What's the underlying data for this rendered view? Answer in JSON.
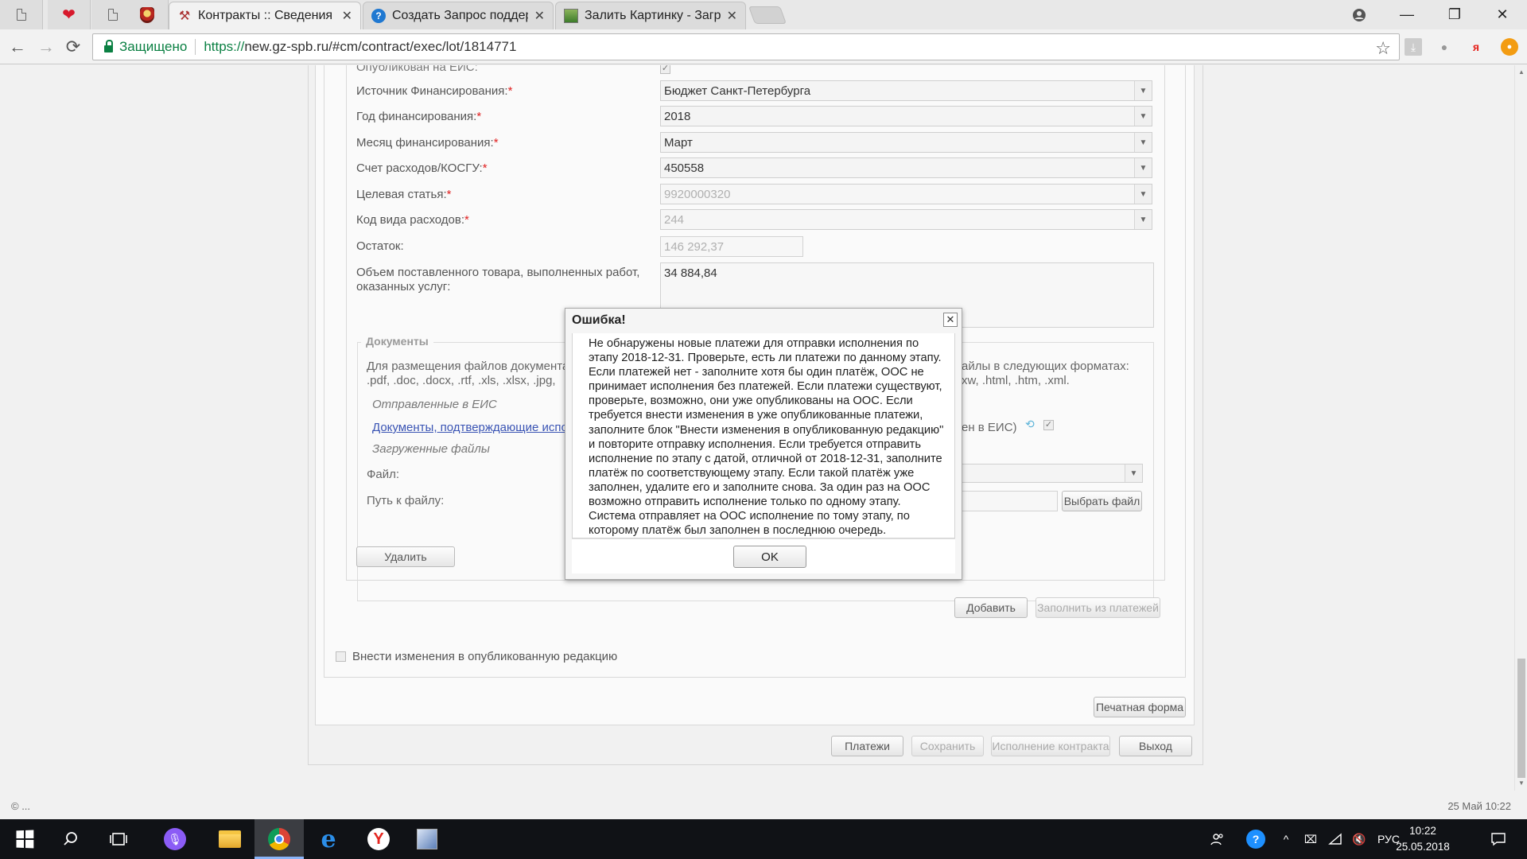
{
  "browser": {
    "tabs": [
      {
        "title": "Контракты :: Сведения о",
        "active": true,
        "icon": "tools-icon"
      },
      {
        "title": "Создать Запрос поддерж",
        "active": false,
        "icon": "help-icon"
      },
      {
        "title": "Залить Картинку - Загру",
        "active": false,
        "icon": "image-icon"
      }
    ],
    "security_label": "Защищено",
    "url_scheme": "https://",
    "url_rest": "new.gz-spb.ru/#cm/contract/exec/lot/1814771",
    "bookmarks_glyph": "☆"
  },
  "form": {
    "published_label": "Опубликован на ЕИС:",
    "funding_source": {
      "label": "Источник Финансирования:",
      "value": "Бюджет Санкт-Петербурга"
    },
    "funding_year": {
      "label": "Год финансирования:",
      "value": "2018"
    },
    "funding_month": {
      "label": "Месяц финансирования:",
      "value": "Март"
    },
    "expense_account": {
      "label": "Счет расходов/КОСГУ:",
      "value": "450558"
    },
    "target_article": {
      "label": "Целевая статья:",
      "value": "9920000320"
    },
    "expense_type_code": {
      "label": "Код вида расходов:",
      "value": "244"
    },
    "remainder": {
      "label": "Остаток:",
      "value": "146 292,37"
    },
    "volume": {
      "label_line1": "Объем поставленного товара, выполненных работ,",
      "label_line2": "оказанных услуг:",
      "value": "34 884,84"
    },
    "required_mark": "*"
  },
  "documents": {
    "title": "Документы",
    "hint_left_1": "Для размещения файлов документа",
    "hint_left_2": ".pdf, .doc, .docx, .rtf, .xls, .xlsx, .jpg,",
    "hint_right_1": "айлы в следующих форматах:",
    "hint_right_2": "xw, .html, .htm, .xml.",
    "sent_label": "Отправленные в ЕИС",
    "confirm_link": "Документы, подтверждающие испо",
    "confirm_suffix": "ен в ЕИС)",
    "uploaded_label": "Загруженные файлы",
    "file_label": "Файл:",
    "path_label": "Путь к файлу:",
    "choose_file_button": "Выбрать файл",
    "delete_button": "Удалить"
  },
  "actions": {
    "add_button": "Добавить",
    "fill_from_payments_button": "Заполнить из платежей",
    "edit_published_label": "Внести изменения в опубликованную редакцию",
    "print_form_button": "Печатная форма",
    "payments_button": "Платежи",
    "save_button": "Сохранить",
    "contract_execution_button": "Исполнение контракта",
    "exit_button": "Выход"
  },
  "footer": {
    "left": "© ...",
    "right": "25 Май 10:22"
  },
  "modal": {
    "title": "Ошибка!",
    "close_glyph": "✕",
    "lines": [
      "Не обнаружены новые платежи для отправки исполнения по",
      "этапу 2018-12-31. Проверьте, есть ли платежи по данному этапу.",
      "Если платежей нет - заполните хотя бы один платёж, ООС не",
      "принимает исполнения без платежей. Если платежи существуют,",
      "проверьте, возможно, они уже опубликованы на ООС. Если",
      "требуется внести изменения в уже опубликованные платежи,",
      "заполните блок \"Внести изменения в опубликованную редакцию\"",
      "и повторите отправку исполнения. Если требуется отправить",
      "исполнение по этапу с датой, отличной от 2018-12-31, заполните",
      "платёж по соответствующему этапу. Если такой платёж уже",
      "заполнен, удалите его и заполните снова. За один раз на ООС",
      "возможно отправить исполнение только по одному этапу.",
      "Система отправляет на ООС исполнение по тому этапу, по",
      "которому платёж был заполнен в последнюю очередь."
    ],
    "ok_button": "OK"
  },
  "taskbar": {
    "language": "РУС",
    "time": "10:22",
    "date": "25.05.2018"
  }
}
